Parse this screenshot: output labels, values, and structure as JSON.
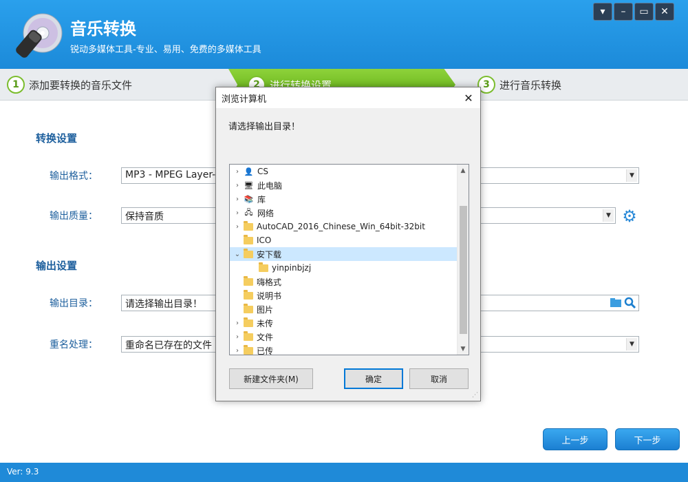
{
  "app": {
    "title": "音乐转换",
    "subtitle": "锐动多媒体工具-专业、易用、免费的多媒体工具",
    "version": "Ver: 9.3"
  },
  "window_controls": [
    "menu-icon",
    "minimize-icon",
    "maximize-icon",
    "close-icon"
  ],
  "steps": [
    {
      "num": "1",
      "label": "添加要转换的音乐文件"
    },
    {
      "num": "2",
      "label": "进行转换设置"
    },
    {
      "num": "3",
      "label": "进行音乐转换"
    }
  ],
  "settings": {
    "convert_title": "转换设置",
    "format_label": "输出格式：",
    "format_value": "MP3 - MPEG Layer-3",
    "quality_label": "输出质量：",
    "quality_value": "保持音质",
    "output_title": "输出设置",
    "dir_label": "输出目录：",
    "dir_value": "请选择输出目录！",
    "rename_label": "重名处理：",
    "rename_value": "重命名已存在的文件"
  },
  "nav": {
    "prev": "上一步",
    "next": "下一步"
  },
  "dialog": {
    "title": "浏览计算机",
    "prompt": "请选择输出目录！",
    "tree": [
      {
        "label": "CS",
        "icon": "user-icon",
        "expander": "›",
        "indent": 0
      },
      {
        "label": "此电脑",
        "icon": "computer-icon",
        "expander": "›",
        "indent": 0
      },
      {
        "label": "库",
        "icon": "library-icon",
        "expander": "›",
        "indent": 0
      },
      {
        "label": "网络",
        "icon": "network-icon",
        "expander": "›",
        "indent": 0
      },
      {
        "label": "AutoCAD_2016_Chinese_Win_64bit-32bit",
        "icon": "folder-icon",
        "expander": "›",
        "indent": 0
      },
      {
        "label": "ICO",
        "icon": "folder-icon",
        "expander": "",
        "indent": 0
      },
      {
        "label": "安下载",
        "icon": "folder-icon",
        "expander": "⌄",
        "indent": 0,
        "selected": true
      },
      {
        "label": "yinpinbjzj",
        "icon": "folder-icon",
        "expander": "",
        "indent": 1
      },
      {
        "label": "嗨格式",
        "icon": "folder-icon",
        "expander": "",
        "indent": 0
      },
      {
        "label": "说明书",
        "icon": "folder-icon",
        "expander": "",
        "indent": 0
      },
      {
        "label": "图片",
        "icon": "folder-icon",
        "expander": "",
        "indent": 0
      },
      {
        "label": "未传",
        "icon": "folder-icon",
        "expander": "›",
        "indent": 0
      },
      {
        "label": "文件",
        "icon": "folder-icon",
        "expander": "›",
        "indent": 0
      },
      {
        "label": "已传",
        "icon": "folder-icon",
        "expander": "›",
        "indent": 0
      }
    ],
    "new_folder": "新建文件夹(M)",
    "ok": "确定",
    "cancel": "取消"
  },
  "colors": {
    "header": "#1c8ad9",
    "accent": "#7bbd2d",
    "label": "#1d5f9d"
  }
}
